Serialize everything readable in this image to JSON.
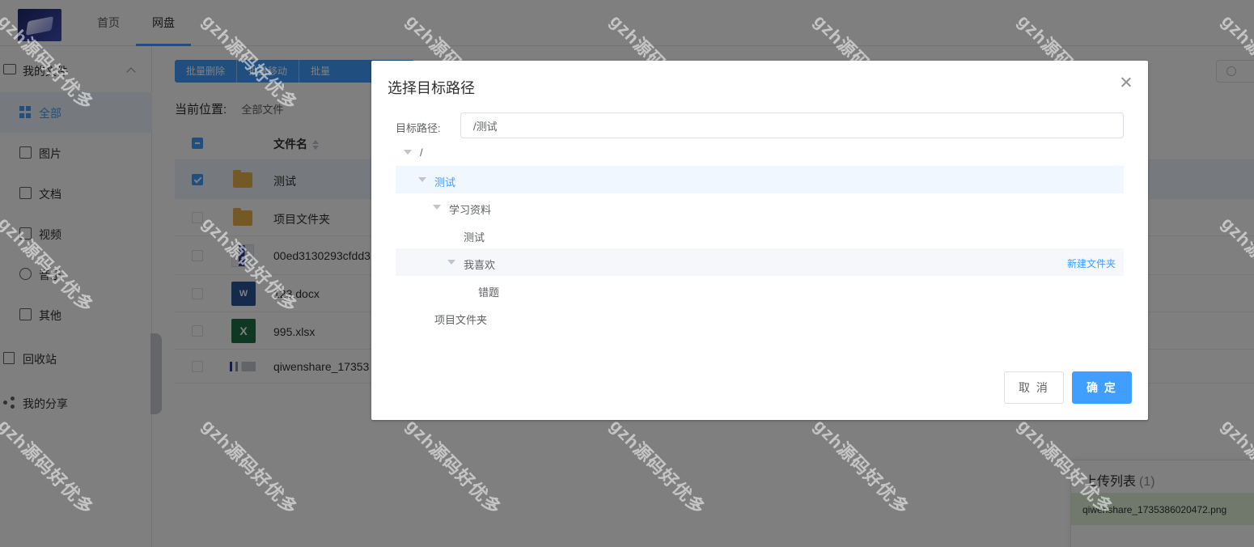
{
  "header": {
    "nav": {
      "home": "首页",
      "disk": "网盘"
    }
  },
  "sidebar": {
    "group_label": "我的文件",
    "items": [
      {
        "label": "全部",
        "icon": "grid-icon"
      },
      {
        "label": "图片",
        "icon": "image-icon"
      },
      {
        "label": "文档",
        "icon": "document-icon"
      },
      {
        "label": "视频",
        "icon": "video-icon"
      },
      {
        "label": "音乐",
        "icon": "music-icon"
      },
      {
        "label": "其他",
        "icon": "other-icon"
      }
    ],
    "recycle": "回收站",
    "share": "我的分享"
  },
  "toolbar": {
    "batch_delete": "批量删除",
    "batch_move": "批量移动",
    "batch_download": "批量"
  },
  "breadcrumb": {
    "label": "当前位置:",
    "current": "全部文件"
  },
  "table": {
    "column_name": "文件名",
    "rows": [
      {
        "name": "测试",
        "checked": true
      },
      {
        "name": "项目文件夹",
        "checked": false
      },
      {
        "name": "00ed3130293cfdd3",
        "checked": false
      },
      {
        "name": "123.docx",
        "checked": false
      },
      {
        "name": "995.xlsx",
        "checked": false
      },
      {
        "name": "qiwenshare_17353",
        "checked": false
      }
    ]
  },
  "upload": {
    "title": "上传列表",
    "count": "(1)",
    "file": "qiwenshare_1735386020472.png",
    "status_color": "#e1f3d8"
  },
  "watermark": "gzh源码好优多",
  "dialog": {
    "title": "选择目标路径",
    "path_label": "目标路径:",
    "path_value": "/测试",
    "tree": {
      "root": "/",
      "n1": "测试",
      "n2": "学习资料",
      "n3": "测试",
      "n4": "我喜欢",
      "n5": "错题",
      "n6": "项目文件夹"
    },
    "new_folder": "新建文件夹",
    "cancel": "取 消",
    "confirm": "确 定"
  },
  "colors": {
    "accent": "#409eff",
    "folder": "#e9b24b"
  }
}
